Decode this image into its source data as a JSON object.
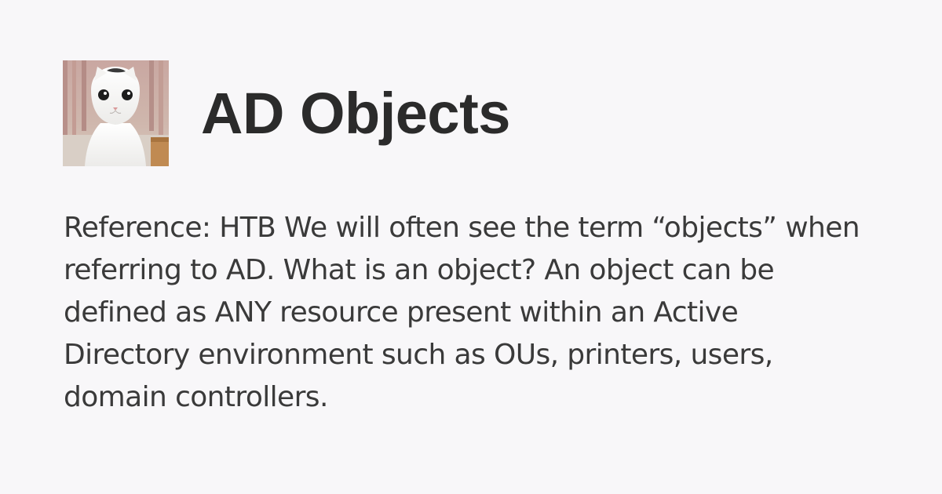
{
  "page": {
    "title": "AD Objects",
    "description": "Reference: HTB We will often see the term “objects” when referring to AD. What is an object? An object can be defined as ANY resource present within an Active Directory environment such as OUs, printers, users, domain controllers."
  },
  "avatar": {
    "icon": "cat-photo-icon"
  },
  "colors": {
    "background": "#f8f7f9",
    "title": "#2b2b2b",
    "text": "#3a3a3a"
  }
}
